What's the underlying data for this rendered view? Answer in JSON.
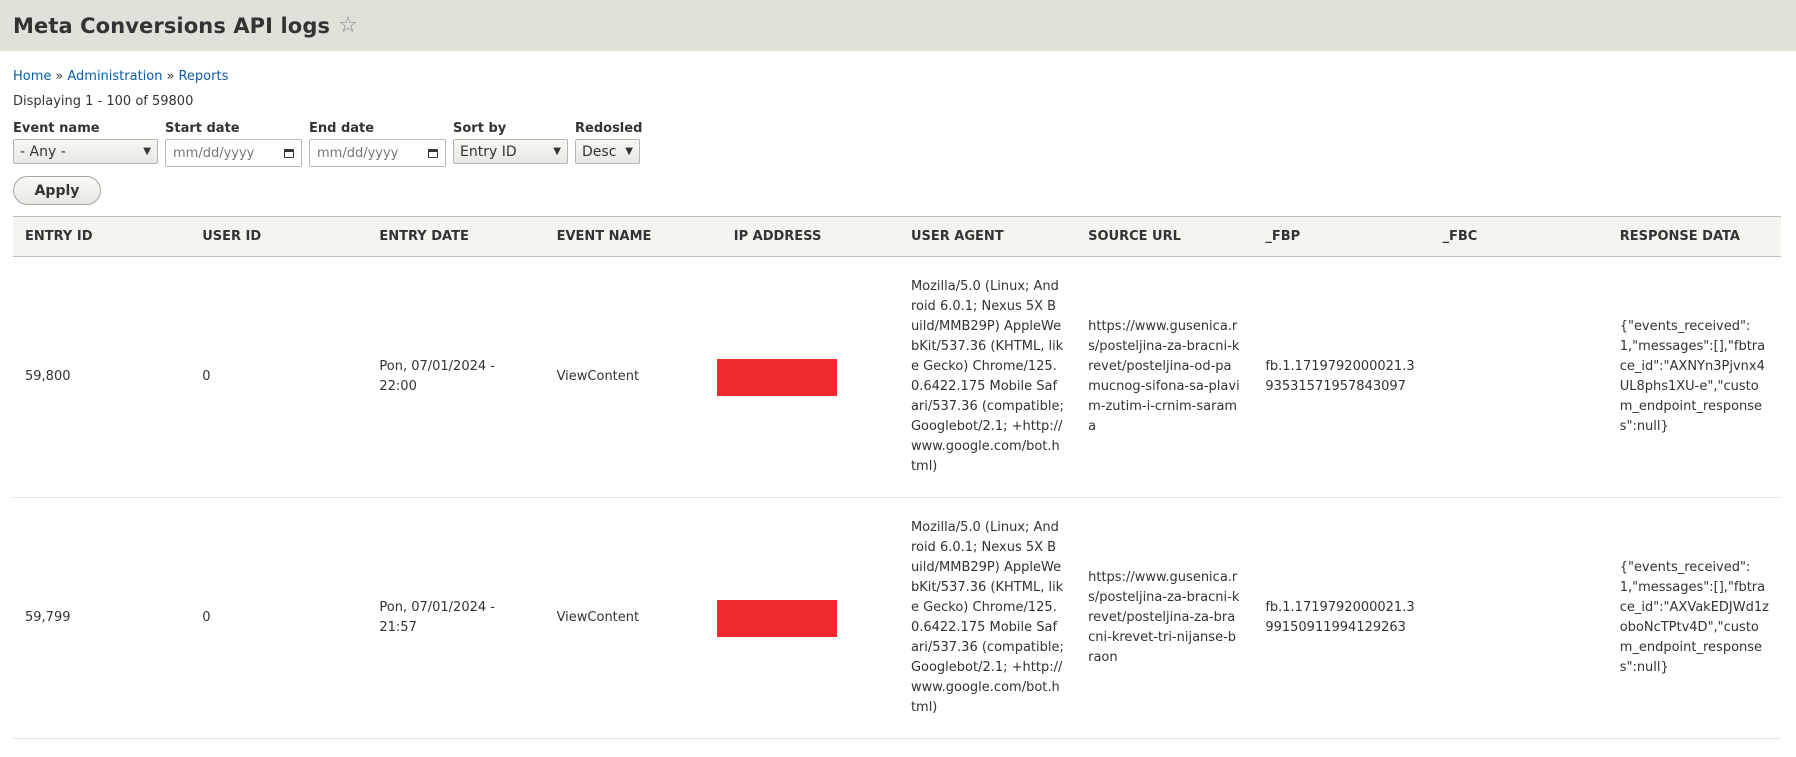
{
  "header": {
    "title": "Meta Conversions API logs",
    "star_icon": "star-outline-icon"
  },
  "breadcrumb": {
    "items": [
      "Home",
      "Administration",
      "Reports"
    ],
    "separator": "»"
  },
  "summary": "Displaying 1 - 100 of 59800",
  "filters": {
    "event_name": {
      "label": "Event name",
      "value": "- Any -"
    },
    "start_date": {
      "label": "Start date",
      "placeholder": "mm/dd/yyyy"
    },
    "end_date": {
      "label": "End date",
      "placeholder": "mm/dd/yyyy"
    },
    "sort_by": {
      "label": "Sort by",
      "value": "Entry ID"
    },
    "order": {
      "label": "Redosled",
      "value": "Desc"
    },
    "apply_label": "Apply"
  },
  "table": {
    "columns": [
      "ENTRY ID",
      "USER ID",
      "ENTRY DATE",
      "EVENT NAME",
      "IP ADDRESS",
      "USER AGENT",
      "SOURCE URL",
      "_FBP",
      "_FBC",
      "RESPONSE DATA"
    ],
    "rows": [
      {
        "entry_id": "59,800",
        "user_id": "0",
        "entry_date": "Pon, 07/01/2024 - 22:00",
        "event_name": "ViewContent",
        "ip_address": "[redacted]",
        "user_agent": "Mozilla/5.0 (Linux; Android 6.0.1; Nexus 5X Build/MMB29P) AppleWebKit/537.36 (KHTML, like Gecko) Chrome/125.0.6422.175 Mobile Safari/537.36 (compatible; Googlebot/2.1; +http://www.google.com/bot.html)",
        "source_url": "https://www.gusenica.rs/posteljina-za-bracni-krevet/posteljina-od-pamucnog-sifona-sa-plavim-zutim-i-crnim-sarama",
        "fbp": "fb.1.1719792000021.393531571957843097",
        "fbc": "",
        "response_data": "{\"events_received\":1,\"messages\":[],\"fbtrace_id\":\"AXNYn3Pjvnx4UL8phs1XU-e\",\"custom_endpoint_responses\":null}"
      },
      {
        "entry_id": "59,799",
        "user_id": "0",
        "entry_date": "Pon, 07/01/2024 - 21:57",
        "event_name": "ViewContent",
        "ip_address": "[redacted]",
        "user_agent": "Mozilla/5.0 (Linux; Android 6.0.1; Nexus 5X Build/MMB29P) AppleWebKit/537.36 (KHTML, like Gecko) Chrome/125.0.6422.175 Mobile Safari/537.36 (compatible; Googlebot/2.1; +http://www.google.com/bot.html)",
        "source_url": "https://www.gusenica.rs/posteljina-za-bracni-krevet/posteljina-za-bracni-krevet-tri-nijanse-braon",
        "fbp": "fb.1.1719792000021.399150911994129263",
        "fbc": "",
        "response_data": "{\"events_received\":1,\"messages\":[],\"fbtrace_id\":\"AXVakEDJWd1zoboNcTPtv4D\",\"custom_endpoint_responses\":null}"
      }
    ]
  },
  "colors": {
    "header_bg": "#e0e2da",
    "link": "#0d5ca8",
    "redaction": "#ef2b2d"
  }
}
